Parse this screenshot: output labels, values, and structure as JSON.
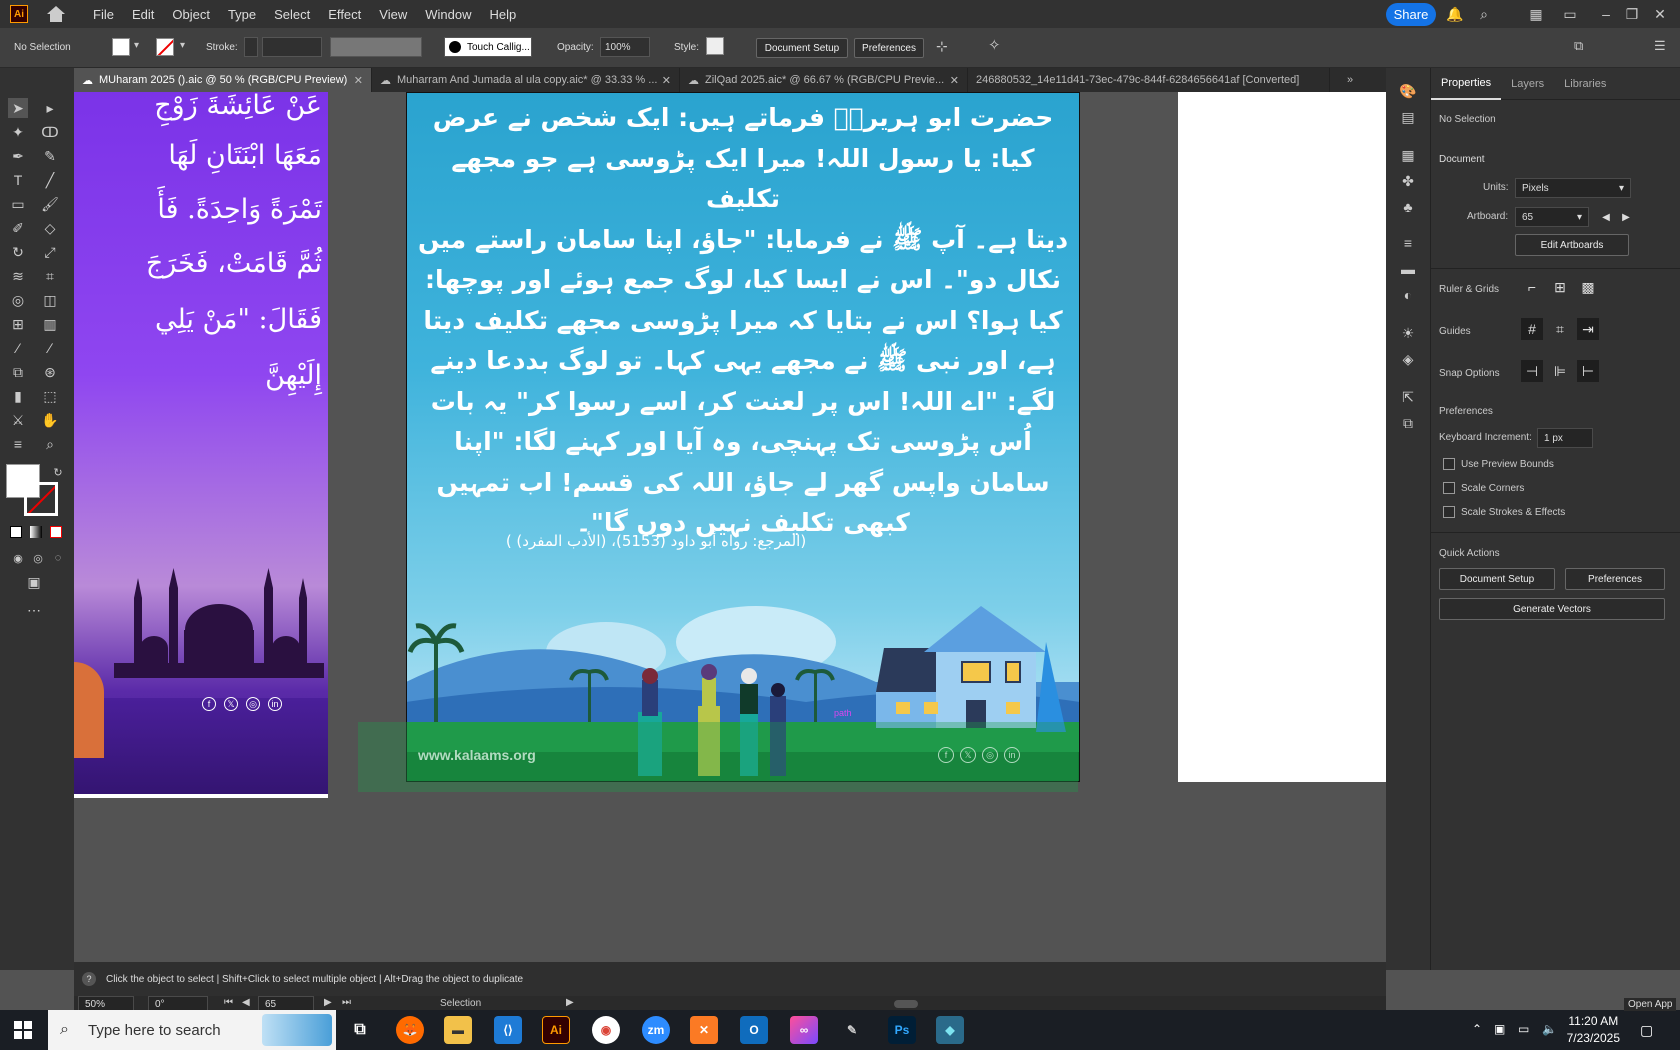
{
  "menubar": {
    "logo": "Ai",
    "items": [
      "File",
      "Edit",
      "Object",
      "Type",
      "Select",
      "Effect",
      "View",
      "Window",
      "Help"
    ],
    "share_label": "Share"
  },
  "control_bar": {
    "selection": "No Selection",
    "stroke_label": "Stroke:",
    "brush": "Touch Callig...",
    "opacity_label": "Opacity:",
    "opacity_value": "100%",
    "style_label": "Style:",
    "document_setup": "Document Setup",
    "preferences": "Preferences"
  },
  "tabs": [
    {
      "label": "MUharam 2025 ().aic @ 50 % (RGB/CPU Preview)",
      "active": true
    },
    {
      "label": "Muharram And Jumada al ula copy.aic* @ 33.33 % ...",
      "active": false
    },
    {
      "label": "ZilQad 2025.aic* @ 66.67 % (RGB/CPU Previe...",
      "active": false
    },
    {
      "label": "246880532_14e11d41-73ec-479c-844f-6284656641af [Converted]",
      "active": false
    }
  ],
  "left_artboard": {
    "lines": [
      "عَنْ عَائِشَةَ زَوْجِ",
      "مَعَهَا ابْنَتَانِ لَهَا",
      "تَمْرَةً وَاحِدَةً. فَأَ",
      "ثُمَّ قَامَتْ، فَخَرَجَ",
      "فَقَالَ: \"مَنْ يَلِي",
      "إِلَيْهِنَّ"
    ]
  },
  "main_artboard": {
    "lines": [
      "حضرت ابو ہریرہؓ فرماتے ہیں: ایک شخص نے عرض",
      "کیا: یا رسول اللہ! میرا ایک پڑوسی ہے جو مجھے تکلیف",
      "دیتا ہے۔ آپ ﷺ نے فرمایا: \"جاؤ، اپنا سامان راستے میں",
      "نکال دو\"۔ اس نے ایسا کیا، لوگ جمع ہوئے اور پوچھا:",
      "کیا ہوا؟ اس نے بتایا کہ میرا پڑوسی مجھے تکلیف دیتا",
      "ہے، اور نبی ﷺ نے مجھے یہی کہا۔ تو لوگ بددعا دینے",
      "لگے: \"اے اللہ! اس پر لعنت کر، اسے رسوا کر\" یہ بات",
      "اُس پڑوسی تک پہنچی، وہ آیا اور کہنے لگا: \"اپنا",
      "سامان واپس گھر لے جاؤ، اللہ کی قسم! اب تمہیں",
      "کبھی تکلیف نہیں دوں گا\"۔"
    ],
    "reference": "(المرجع: رواه أبو داود (5153)، (الأدب المفرد) )",
    "website": "www.kalaams.org",
    "path_label": "path"
  },
  "properties": {
    "tabs": [
      "Properties",
      "Layers",
      "Libraries"
    ],
    "no_selection": "No Selection",
    "document_label": "Document",
    "units_label": "Units:",
    "units_value": "Pixels",
    "artboard_label": "Artboard:",
    "artboard_value": "65",
    "edit_artboards": "Edit Artboards",
    "ruler_grids": "Ruler & Grids",
    "guides": "Guides",
    "snap_options": "Snap Options",
    "preferences_label": "Preferences",
    "keyboard_increment_label": "Keyboard Increment:",
    "keyboard_increment_value": "1 px",
    "checks": [
      "Use Preview Bounds",
      "Scale Corners",
      "Scale Strokes & Effects"
    ],
    "quick_actions": "Quick Actions",
    "document_setup": "Document Setup",
    "preferences_btn": "Preferences",
    "generate_vectors": "Generate Vectors"
  },
  "status": {
    "hint": "Click the object to select  |  Shift+Click to select multiple object  |  Alt+Drag the object to duplicate",
    "zoom": "50%",
    "rotation": "0°",
    "artboard": "65",
    "tool": "Selection"
  },
  "taskbar": {
    "search_placeholder": "Type here to search",
    "time": "11:20 AM",
    "date": "7/23/2025",
    "open_app": "Open App"
  }
}
